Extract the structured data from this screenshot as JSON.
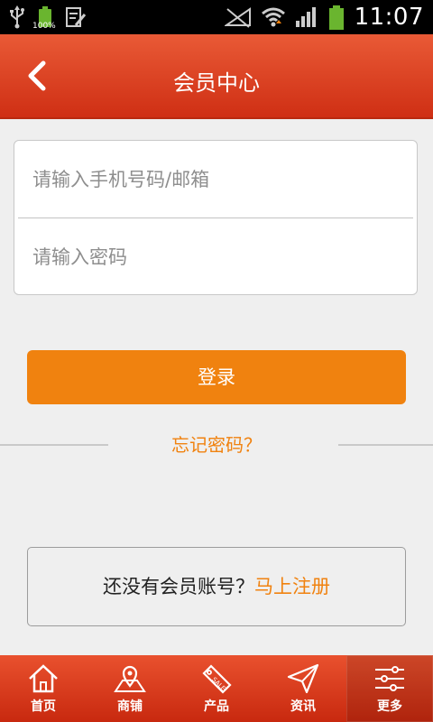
{
  "status_bar": {
    "battery_percent": "100%",
    "time": "11:07"
  },
  "header": {
    "title": "会员中心",
    "back_icon": "chevron-left-icon"
  },
  "login_form": {
    "account_placeholder": "请输入手机号码/邮箱",
    "password_placeholder": "请输入密码",
    "account_value": "",
    "password_value": ""
  },
  "login_button": "登录",
  "forgot_password": "忘记密码？",
  "register": {
    "question": "还没有会员账号？",
    "link": "马上注册"
  },
  "tabbar": {
    "items": [
      {
        "label": "首页",
        "icon": "home-icon"
      },
      {
        "label": "商铺",
        "icon": "map-pin-icon"
      },
      {
        "label": "产品",
        "icon": "sale-tag-icon"
      },
      {
        "label": "资讯",
        "icon": "paper-plane-icon"
      },
      {
        "label": "更多",
        "icon": "sliders-icon",
        "active": true
      }
    ]
  },
  "colors": {
    "header": "#d9391a",
    "accent_orange": "#f0820f",
    "background": "#efefef"
  }
}
